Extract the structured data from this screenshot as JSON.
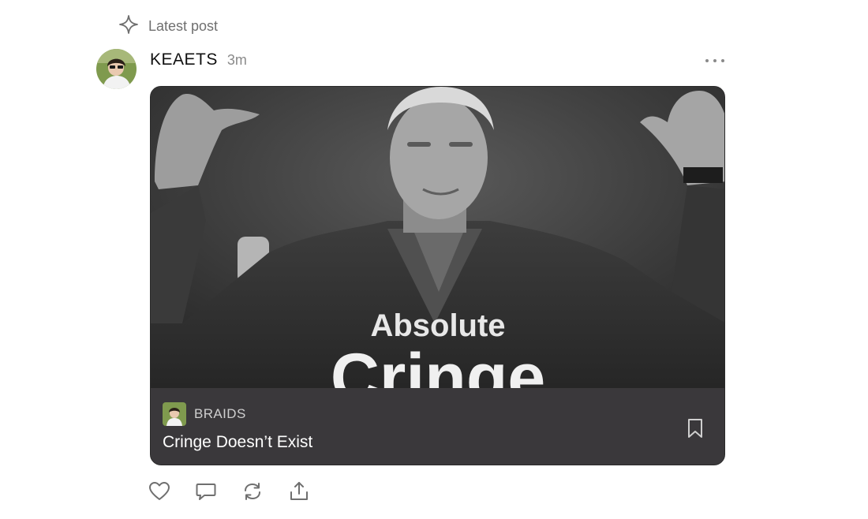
{
  "context": {
    "label": "Latest post",
    "icon": "sparkle-icon"
  },
  "post": {
    "author": "KEAETS",
    "time": "3m",
    "more_icon": "more-horizontal-icon"
  },
  "card": {
    "image_text_line1": "Absolute",
    "image_text_line2": "Cringe",
    "publication": "BRAIDS",
    "title": "Cringe Doesn’t Exist",
    "bookmark_icon": "bookmark-icon"
  },
  "actions": [
    {
      "name": "like",
      "icon": "heart-icon"
    },
    {
      "name": "comment",
      "icon": "comment-icon"
    },
    {
      "name": "restack",
      "icon": "restack-icon"
    },
    {
      "name": "share",
      "icon": "share-icon"
    }
  ],
  "colors": {
    "card_footer": "#3a383b",
    "muted_text": "#8a8a8a"
  }
}
